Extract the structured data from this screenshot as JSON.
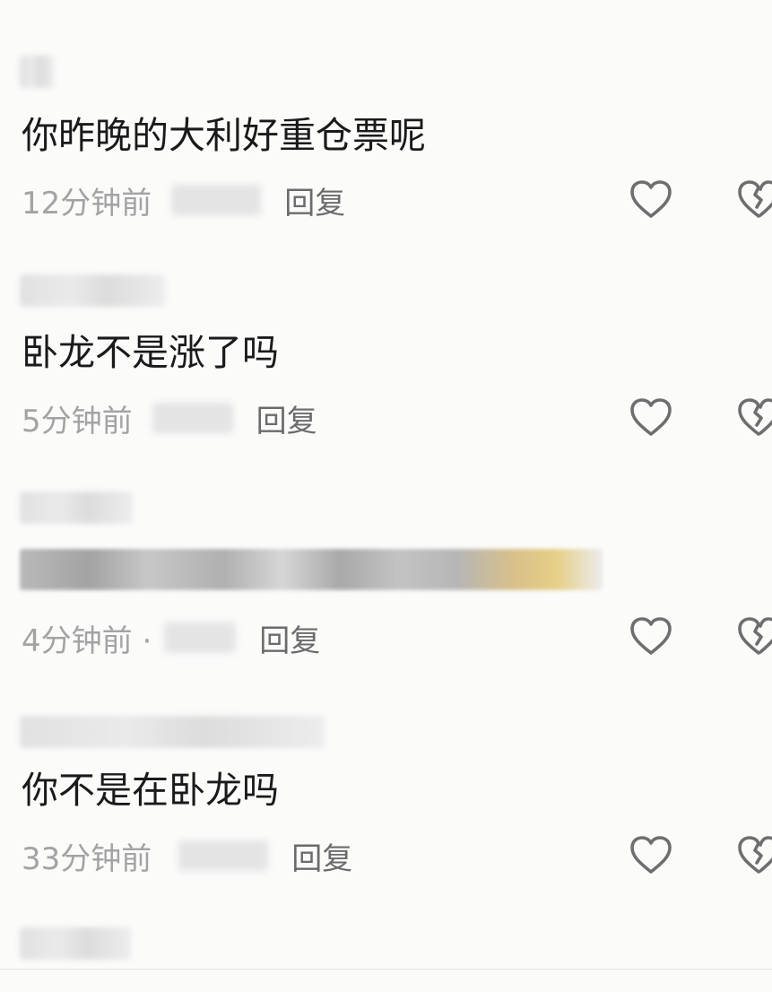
{
  "comments": [
    {
      "content": "你昨晚的大利好重仓票呢",
      "time": "12分钟前",
      "reply": "回复",
      "content_blurred": false
    },
    {
      "content": "卧龙不是涨了吗",
      "time": "5分钟前",
      "reply": "回复",
      "content_blurred": false
    },
    {
      "content": "",
      "time": "4分钟前 ·",
      "reply": "回复",
      "content_blurred": true
    },
    {
      "content": "你不是在卧龙吗",
      "time": "33分钟前",
      "reply": "回复",
      "content_blurred": false
    }
  ],
  "icons": {
    "like": "heart-outline-icon",
    "dislike": "broken-heart-icon",
    "color": "#6e6e6e"
  }
}
